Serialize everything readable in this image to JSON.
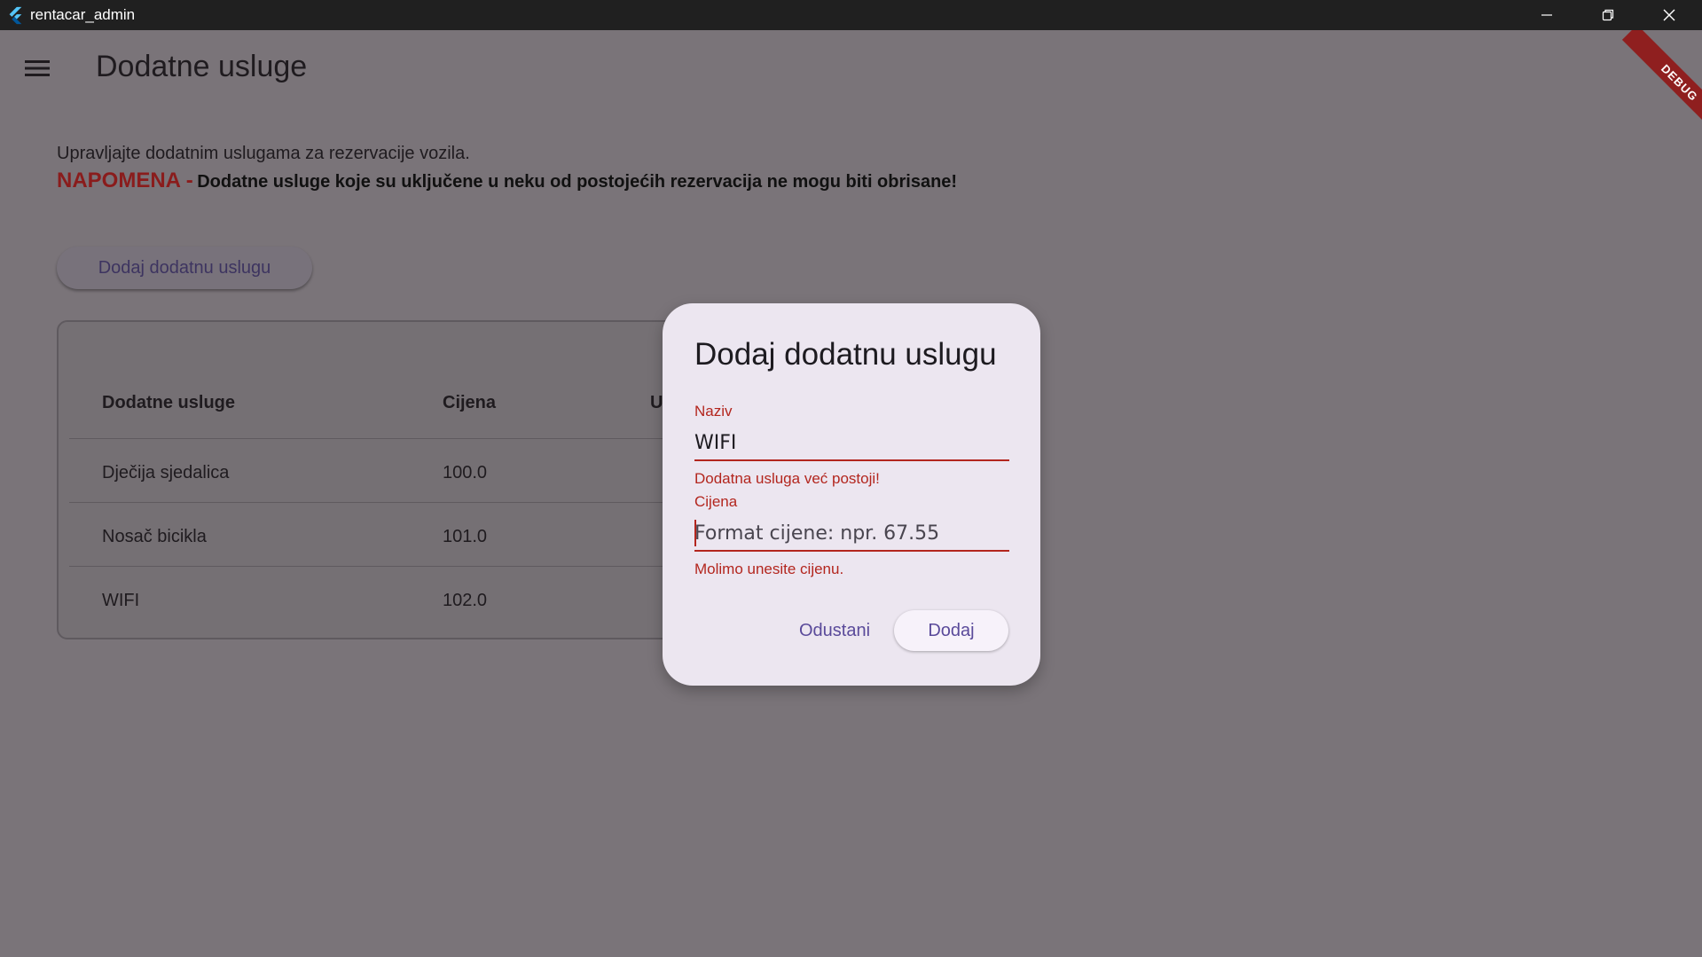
{
  "window": {
    "title": "rentacar_admin"
  },
  "header": {
    "title": "Dodatne usluge"
  },
  "intro": {
    "description": "Upravljajte dodatnim uslugama za rezervacije vozila.",
    "note_label": "NAPOMENA -",
    "note_text": "Dodatne usluge koje su uključene u neku od postojećih rezervacija ne mogu biti obrisane!"
  },
  "actions": {
    "add_label": "Dodaj dodatnu uslugu"
  },
  "table": {
    "columns": [
      "Dodatne usluge",
      "Cijena",
      "U"
    ],
    "rows": [
      {
        "name": "Dječija sjedalica",
        "price": "100.0"
      },
      {
        "name": "Nosač bicikla",
        "price": "101.0"
      },
      {
        "name": "WIFI",
        "price": "102.0"
      }
    ]
  },
  "debug_banner": "DEBUG",
  "dialog": {
    "title": "Dodaj dodatnu uslugu",
    "name_label": "Naziv",
    "name_value": "WIFI",
    "name_error": "Dodatna usluga već postoji!",
    "price_label": "Cijena",
    "price_value": "",
    "price_placeholder": "Format cijene: npr. 67.55",
    "price_error": "Molimo unesite cijenu.",
    "cancel_label": "Odustani",
    "confirm_label": "Dodaj"
  },
  "colors": {
    "error": "#b3261e",
    "accent": "#5a4a9a",
    "dialog_bg": "#ece6f0",
    "scrim_bg": "#7a7479"
  },
  "icons": {
    "app": "flutter-logo-icon",
    "menu": "hamburger-menu-icon",
    "minimize": "minimize-icon",
    "restore": "restore-icon",
    "close": "close-icon"
  }
}
